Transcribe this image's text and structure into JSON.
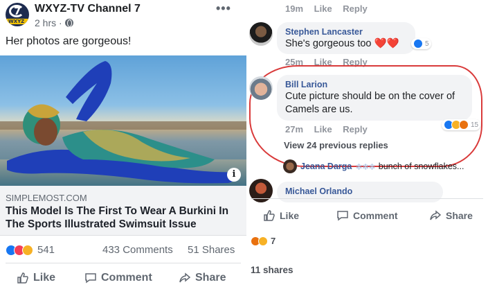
{
  "left_post": {
    "page_name": "WXYZ-TV Channel 7",
    "logo_number": "7",
    "logo_word": "WXYZ",
    "time": "2 hrs ·",
    "more": "•••",
    "caption": "Her photos are gorgeous!",
    "link_domain": "SIMPLEMOST.COM",
    "link_title": "This Model Is The First To Wear A Burkini In The Sports Illustrated Swimsuit Issue",
    "info": "i",
    "reaction_count": "541",
    "comments": "433 Comments",
    "shares": "51 Shares",
    "actions": {
      "like": "Like",
      "comment": "Comment",
      "share": "Share"
    }
  },
  "right_thread": {
    "top_meta": {
      "time": "19m",
      "like": "Like",
      "reply": "Reply"
    },
    "comments": [
      {
        "name": "Stephen Lancaster",
        "text": "She's gorgeous too ❤️❤️",
        "time": "25m",
        "like": "Like",
        "reply": "Reply",
        "reactions": "5"
      },
      {
        "name": "Bill Larion",
        "text": "Cute picture should be on the cover of Camels are us.",
        "time": "27m",
        "like": "Like",
        "reply": "Reply",
        "reactions": "15"
      }
    ],
    "view_previous": "View 24 previous replies",
    "reply_preview": {
      "name": "Jeana Darga",
      "symbols": "❄❄❄",
      "text": "bunch of snowflakes..."
    },
    "next_commenter": "Michael Orlando",
    "actions": {
      "like": "Like",
      "comment": "Comment",
      "share": "Share"
    },
    "reaction_count": "7",
    "shares": "11 shares"
  },
  "colors": {
    "facebook_blue": "#1877f2",
    "name_link": "#385898",
    "highlight_circle": "#d93a3a",
    "love_red": "#f33e58",
    "haha_yellow": "#f7b125"
  },
  "icons": [
    "globe-icon",
    "more-icon",
    "info-icon",
    "thumbs-up-icon",
    "comment-icon",
    "share-icon",
    "like-reaction-icon",
    "love-reaction-icon",
    "haha-reaction-icon",
    "angry-reaction-icon",
    "wow-reaction-icon"
  ]
}
